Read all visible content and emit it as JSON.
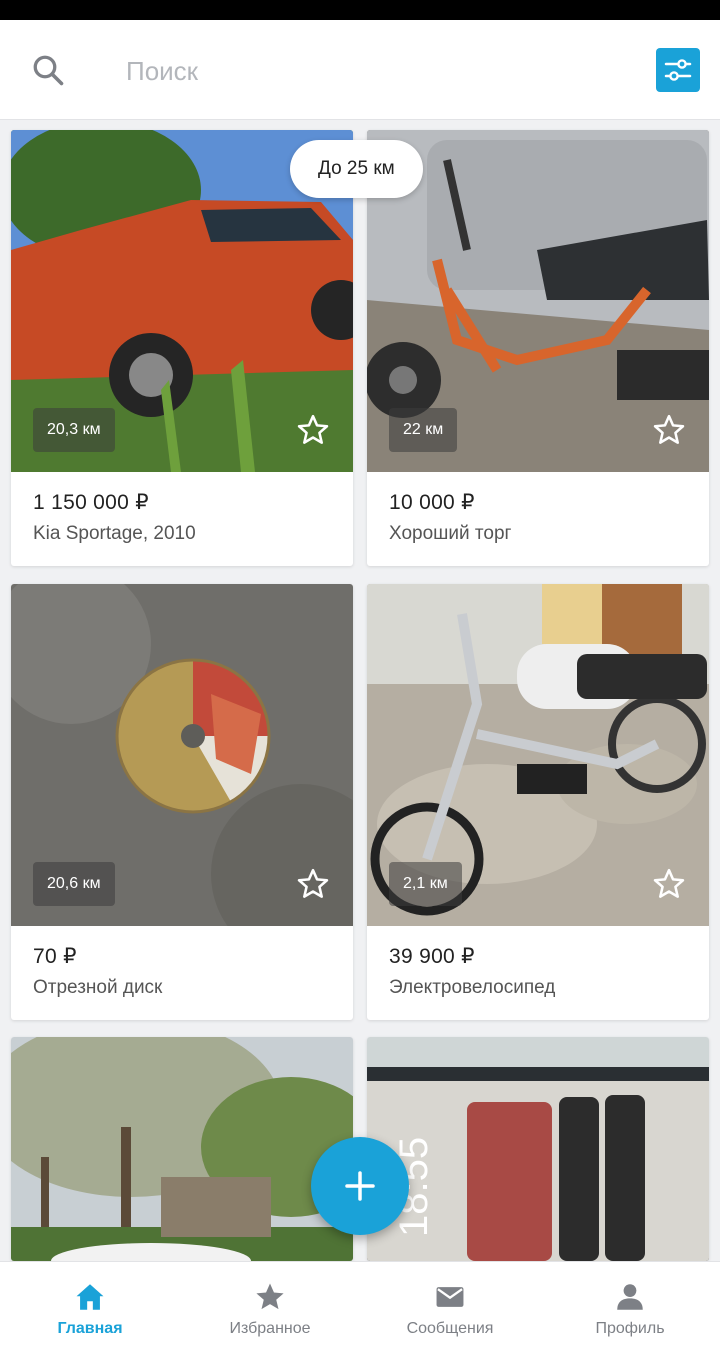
{
  "search": {
    "placeholder": "Поиск"
  },
  "radius_chip": "До 25 км",
  "colors": {
    "accent": "#1aa2d8",
    "inactive": "#7d8086"
  },
  "listings": [
    {
      "distance": "20,3 км",
      "price": "1 150 000 ₽",
      "title": "Kia Sportage, 2010"
    },
    {
      "distance": "22 км",
      "price": "10 000 ₽",
      "title": "Хороший торг"
    },
    {
      "distance": "20,6 км",
      "price": "70 ₽",
      "title": "Отрезной диск"
    },
    {
      "distance": "2,1 км",
      "price": "39 900 ₽",
      "title": "Электровелосипед"
    }
  ],
  "nav": [
    {
      "label": "Главная",
      "icon": "home-icon",
      "active": true
    },
    {
      "label": "Избранное",
      "icon": "star-icon",
      "active": false
    },
    {
      "label": "Сообщения",
      "icon": "mail-icon",
      "active": false
    },
    {
      "label": "Профиль",
      "icon": "person-icon",
      "active": false
    }
  ]
}
